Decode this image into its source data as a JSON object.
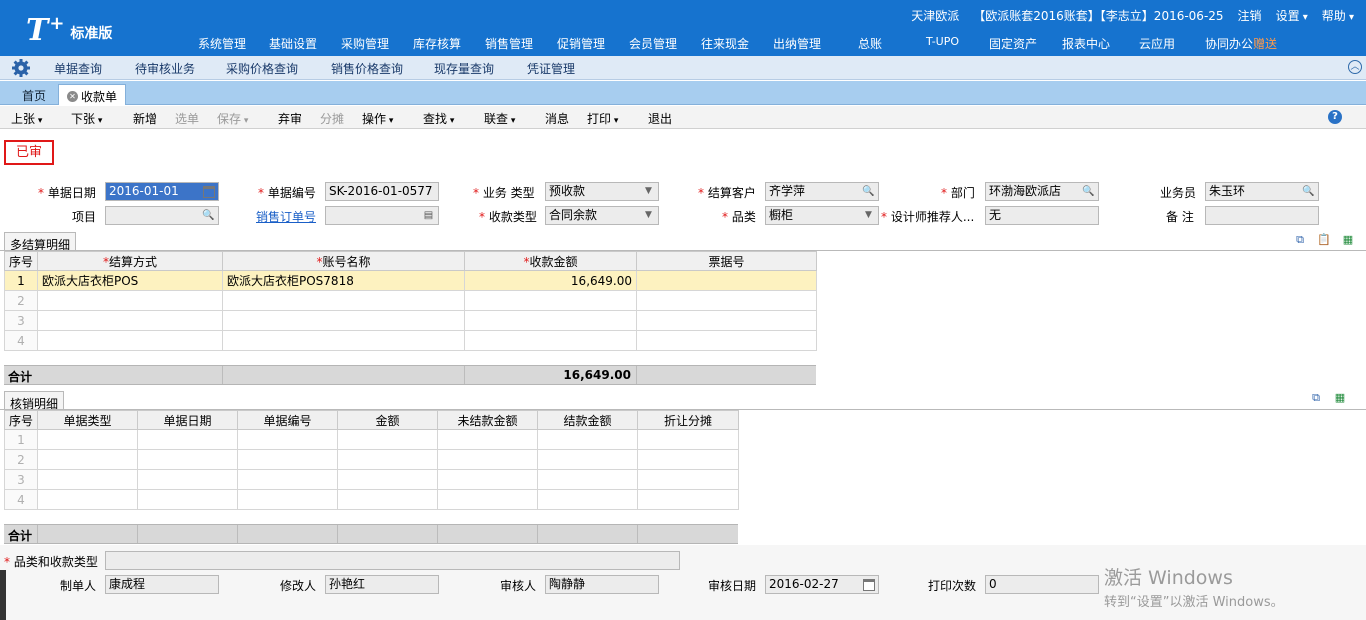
{
  "app": {
    "logo_t": "T",
    "logo_plus": "+",
    "edition": "标准版"
  },
  "topinfo": {
    "company": "天津欧派",
    "account": "【欧派账套2016账套】【李志立】2016-06-25",
    "logout": "注销",
    "settings": "设置",
    "help": "帮助"
  },
  "mainnav": [
    "系统管理",
    "基础设置",
    "采购管理",
    "库存核算",
    "销售管理",
    "促销管理",
    "会员管理",
    "往来现金",
    "出纳管理",
    "总账",
    "T-UPO",
    "固定资产",
    "报表中心",
    "云应用",
    "协同办公"
  ],
  "mainnav_badge": "赠送",
  "quicklinks": [
    "单据查询",
    "待审核业务",
    "采购价格查询",
    "销售价格查询",
    "现存量查询",
    "凭证管理"
  ],
  "tabs": {
    "home": "首页",
    "active": "收款单"
  },
  "toolbar": {
    "prev": "上张",
    "next": "下张",
    "new": "新增",
    "select": "选单",
    "save": "保存",
    "unaudit": "弃审",
    "allocate": "分摊",
    "operate": "操作",
    "find": "查找",
    "linked": "联查",
    "message": "消息",
    "print": "打印",
    "exit": "退出"
  },
  "status_stamp": "已审",
  "form": {
    "doc_date_label": "单据日期",
    "doc_date": "2016-01-01",
    "doc_no_label": "单据编号",
    "doc_no": "SK-2016-01-0577",
    "biz_type_label": "业务 类型",
    "biz_type": "预收款",
    "customer_label": "结算客户",
    "customer": "齐学萍",
    "dept_label": "部门",
    "dept": "环渤海欧派店",
    "salesman_label": "业务员",
    "salesman": "朱玉环",
    "project_label": "项目",
    "project": "",
    "sales_order_label": "销售订单号",
    "sales_order": "",
    "receipt_type_label": "收款类型",
    "receipt_type": "合同余款",
    "category_label": "品类",
    "category": "橱柜",
    "designer_label": "设计师推荐人...",
    "designer": "无",
    "remark_label": "备 注",
    "remark": ""
  },
  "settlement": {
    "title": "多结算明细",
    "columns": [
      "序号",
      "结算方式",
      "账号名称",
      "收款金额",
      "票据号"
    ],
    "rows": [
      {
        "seq": "1",
        "method": "欧派大店衣柜POS",
        "account": "欧派大店衣柜POS7818",
        "amount": "16,649.00",
        "bill": ""
      },
      {
        "seq": "2",
        "method": "",
        "account": "",
        "amount": "",
        "bill": ""
      },
      {
        "seq": "3",
        "method": "",
        "account": "",
        "amount": "",
        "bill": ""
      },
      {
        "seq": "4",
        "method": "",
        "account": "",
        "amount": "",
        "bill": ""
      }
    ],
    "total_label": "合计",
    "total_amount": "16,649.00"
  },
  "writeoff": {
    "title": "核销明细",
    "columns": [
      "序号",
      "单据类型",
      "单据日期",
      "单据编号",
      "金额",
      "未结款金额",
      "结款金额",
      "折让分摊"
    ],
    "rows": [
      "1",
      "2",
      "3",
      "4"
    ],
    "total_label": "合计"
  },
  "footer": {
    "cat_type_label": "品类和收款类型",
    "cat_type": "",
    "maker_label": "制单人",
    "maker": "康成程",
    "modifier_label": "修改人",
    "modifier": "孙艳红",
    "auditor_label": "审核人",
    "auditor": "陶静静",
    "audit_date_label": "审核日期",
    "audit_date": "2016-02-27",
    "print_count_label": "打印次数",
    "print_count": "0"
  },
  "watermark": {
    "line1": "激活 Windows",
    "line2": "转到“设置”以激活 Windows。"
  }
}
